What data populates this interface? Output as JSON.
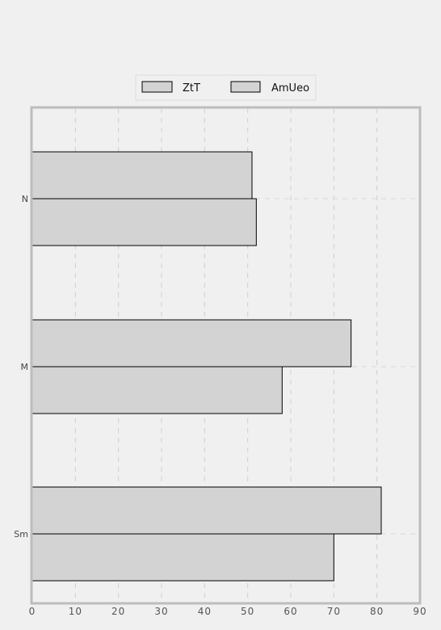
{
  "chart_data": {
    "type": "bar",
    "orientation": "horizontal",
    "categories": [
      "N",
      "M",
      "Sm"
    ],
    "series": [
      {
        "name": "ZtT",
        "values": [
          51,
          74,
          81
        ]
      },
      {
        "name": "AmUeo",
        "values": [
          52,
          58,
          70
        ]
      }
    ],
    "xlim": [
      0,
      90
    ],
    "xticks": [
      "0",
      "10",
      "20",
      "30",
      "40",
      "50",
      "60",
      "70",
      "80",
      "90"
    ],
    "grid": true,
    "legend_position": "top-center",
    "colors": {
      "bar_fill": "#d3d3d3",
      "bar_stroke": "#000000",
      "frame": "#bdbdbd",
      "background": "#f0f0f0"
    }
  }
}
